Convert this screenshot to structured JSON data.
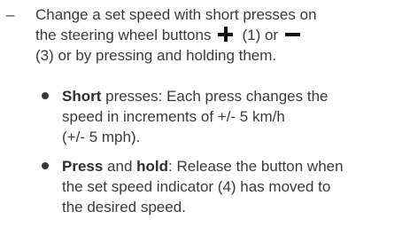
{
  "instruction": {
    "dash": "–",
    "line1": "Change a set speed with short presses on",
    "line2_prefix": "the steering wheel buttons",
    "line2_plus_ref": "(1) or",
    "line3_prefix": "(3) or by pressing and holding them.",
    "plus_icon": "plus-icon",
    "minus_icon": "minus-icon"
  },
  "bullets": [
    {
      "bold1": "Short",
      "text1": " presses: Each press changes the",
      "line2": "speed in increments of +/- 5 km/h",
      "line3": "(+/- 5 mph)."
    },
    {
      "bold1": "Press",
      "text1": " and ",
      "bold2": "hold",
      "text2": ": Release the button when",
      "line2": "the set speed indicator (4) has moved to",
      "line3": "the desired speed."
    }
  ]
}
